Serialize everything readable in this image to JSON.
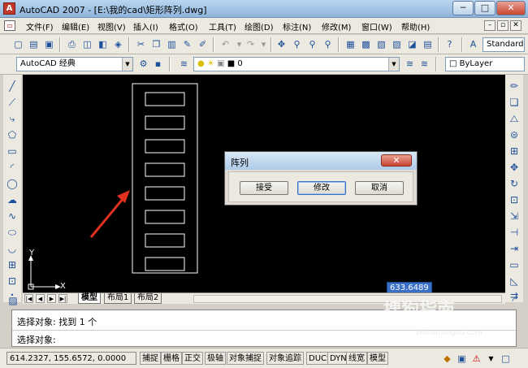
{
  "window": {
    "title": "AutoCAD 2007 - [E:\\我的cad\\矩形阵列.dwg]",
    "app_icon": "autocad-logo",
    "minimize": "─",
    "maximize": "□",
    "close": "✕"
  },
  "menu": {
    "items": [
      "文件(F)",
      "编辑(E)",
      "视图(V)",
      "插入(I)",
      "格式(O)",
      "工具(T)",
      "绘图(D)",
      "标注(N)",
      "修改(M)",
      "窗口(W)",
      "帮助(H)"
    ],
    "mdi_minimize": "–",
    "mdi_restore": "▫",
    "mdi_close": "✕"
  },
  "toolbar": {
    "text_style": "Standard"
  },
  "workspace": {
    "value": "AutoCAD 经典"
  },
  "layer": {
    "value": "0"
  },
  "color": {
    "value": "ByLayer"
  },
  "ucs": {
    "y_label": "Y",
    "x_label": "X"
  },
  "tabs": {
    "nav": [
      "|◀",
      "◀",
      "▶",
      "▶|"
    ],
    "items": [
      "模型",
      "布局1",
      "布局2"
    ]
  },
  "dialog": {
    "title": "阵列",
    "buttons": {
      "accept": "接受",
      "modify": "修改",
      "cancel": "取消"
    }
  },
  "dimension_input": "633.6489",
  "command": {
    "line1": "选择对象: 找到 1 个",
    "line2": "选择对象:"
  },
  "status": {
    "coords": "614.2327,  155.6572, 0.0000",
    "buttons": [
      "捕捉",
      "栅格",
      "正交",
      "极轴",
      "对象捕捉",
      "对象追踪",
      "DUCS",
      "DYN",
      "线宽",
      "模型"
    ]
  },
  "watermark": {
    "text": "搜狗指南",
    "url": "zhinan.sogou.com"
  },
  "colors": {
    "canvas": "#000000",
    "geometry": "#ffffff",
    "arrow": "#e03020"
  }
}
